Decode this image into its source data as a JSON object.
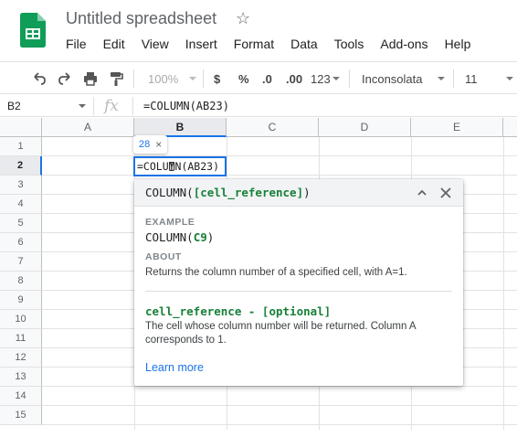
{
  "doc": {
    "title": "Untitled spreadsheet"
  },
  "menu": [
    "File",
    "Edit",
    "View",
    "Insert",
    "Format",
    "Data",
    "Tools",
    "Add-ons",
    "Help"
  ],
  "toolbar": {
    "zoom": "100%",
    "currency": "$",
    "percent": "%",
    "decrease_decimals": ".0",
    "increase_decimals": ".00",
    "more_formats": "123",
    "font": "Inconsolata",
    "font_size": "11"
  },
  "formula_bar": {
    "cell_ref": "B2",
    "fx": "fx",
    "content": "=COLUMN(AB23)"
  },
  "grid": {
    "columns": [
      "A",
      "B",
      "C",
      "D",
      "E"
    ],
    "rows": [
      "1",
      "2",
      "3",
      "4",
      "5",
      "6",
      "7",
      "8",
      "9",
      "10",
      "11",
      "12",
      "13",
      "14",
      "15"
    ],
    "active_cell_value": "=COLUMN(AB23)",
    "result_chip": "28"
  },
  "help": {
    "func": "COLUMN(",
    "param": "[cell_reference]",
    "close_paren": ")",
    "example_label": "EXAMPLE",
    "example_func": "COLUMN(",
    "example_arg": "C9",
    "example_close": ")",
    "about_label": "ABOUT",
    "about_text": "Returns the column number of a specified cell, with A=1.",
    "arg_title": "cell_reference - [optional]",
    "arg_desc": "The cell whose column number will be returned. Column A corresponds to 1.",
    "learn_more": "Learn more"
  },
  "colors": {
    "accent": "#1a73e8",
    "green": "#188038",
    "sheets_green": "#0f9d58"
  }
}
